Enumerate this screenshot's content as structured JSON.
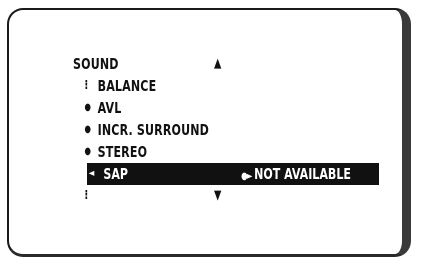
{
  "menu": {
    "title": "SOUND",
    "up_arrow": "▲",
    "down_arrow": "▼",
    "scroll_marker": "⁝",
    "bullet": "●",
    "items": [
      {
        "label": "BALANCE",
        "marker": "⁝"
      },
      {
        "label": "AVL",
        "marker": "●"
      },
      {
        "label": "INCR. SURROUND",
        "marker": "●"
      },
      {
        "label": "STEREO",
        "marker": "●"
      }
    ],
    "selected": {
      "arrow": "◄",
      "label": "SAP",
      "nav": "●►",
      "status": "NOT AVAILABLE"
    },
    "bottom_marker": "⁝"
  },
  "colors": {
    "highlight_bg": "#111111",
    "highlight_text": "#ffffff",
    "text": "#111111"
  }
}
